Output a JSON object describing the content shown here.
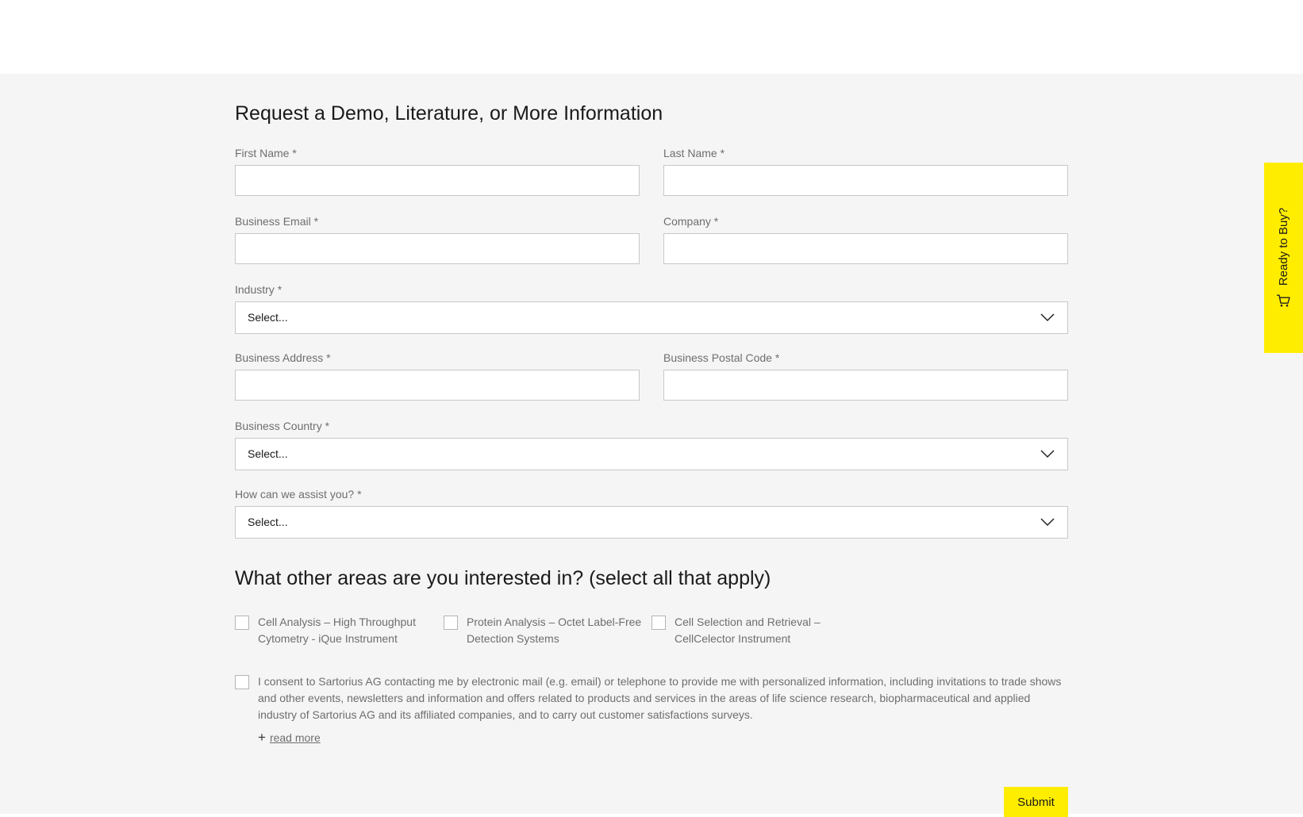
{
  "form": {
    "title": "Request a Demo, Literature, or More Information",
    "fields": {
      "first_name": {
        "label": "First Name *",
        "value": ""
      },
      "last_name": {
        "label": "Last Name *",
        "value": ""
      },
      "business_email": {
        "label": "Business Email *",
        "value": ""
      },
      "company": {
        "label": "Company *",
        "value": ""
      },
      "industry": {
        "label": "Industry *",
        "selected": "Select..."
      },
      "business_address": {
        "label": "Business Address *",
        "value": ""
      },
      "business_postal_code": {
        "label": "Business Postal Code *",
        "value": ""
      },
      "business_country": {
        "label": "Business Country *",
        "selected": "Select..."
      },
      "assist": {
        "label": "How can we assist you? *",
        "selected": "Select..."
      }
    },
    "interests": {
      "title": "What other areas are you interested in? (select all that apply)",
      "options": [
        {
          "line1": "Cell Analysis – High Throughput",
          "line2": "Cytometry - iQue Instrument",
          "checked": false
        },
        {
          "line1": "Protein Analysis – Octet Label-Free",
          "line2": "Detection Systems",
          "checked": false
        },
        {
          "line1": "Cell Selection and Retrieval –",
          "line2": "CellCelector Instrument",
          "checked": false
        }
      ]
    },
    "consent": {
      "line1": "I consent to Sartorius AG contacting me by electronic mail (e.g. email) or telephone to provide me with personalized information, including invitations to trade shows",
      "line2": "and other events, newsletters and information and offers related to products and services in the areas of life science research, biopharmaceutical and applied",
      "line3": "industry of Sartorius AG and its affiliated companies, and to carry out customer satisfactions surveys.",
      "checked": false,
      "read_more": "read more"
    },
    "submit_label": "Submit"
  },
  "side_tab": {
    "label": "Ready to Buy?",
    "icon": "cart-icon",
    "color": "#ffed00"
  },
  "colors": {
    "accent": "#ffed00",
    "panel_background": "#f5f5f5",
    "label_text": "#6e6e6e"
  }
}
